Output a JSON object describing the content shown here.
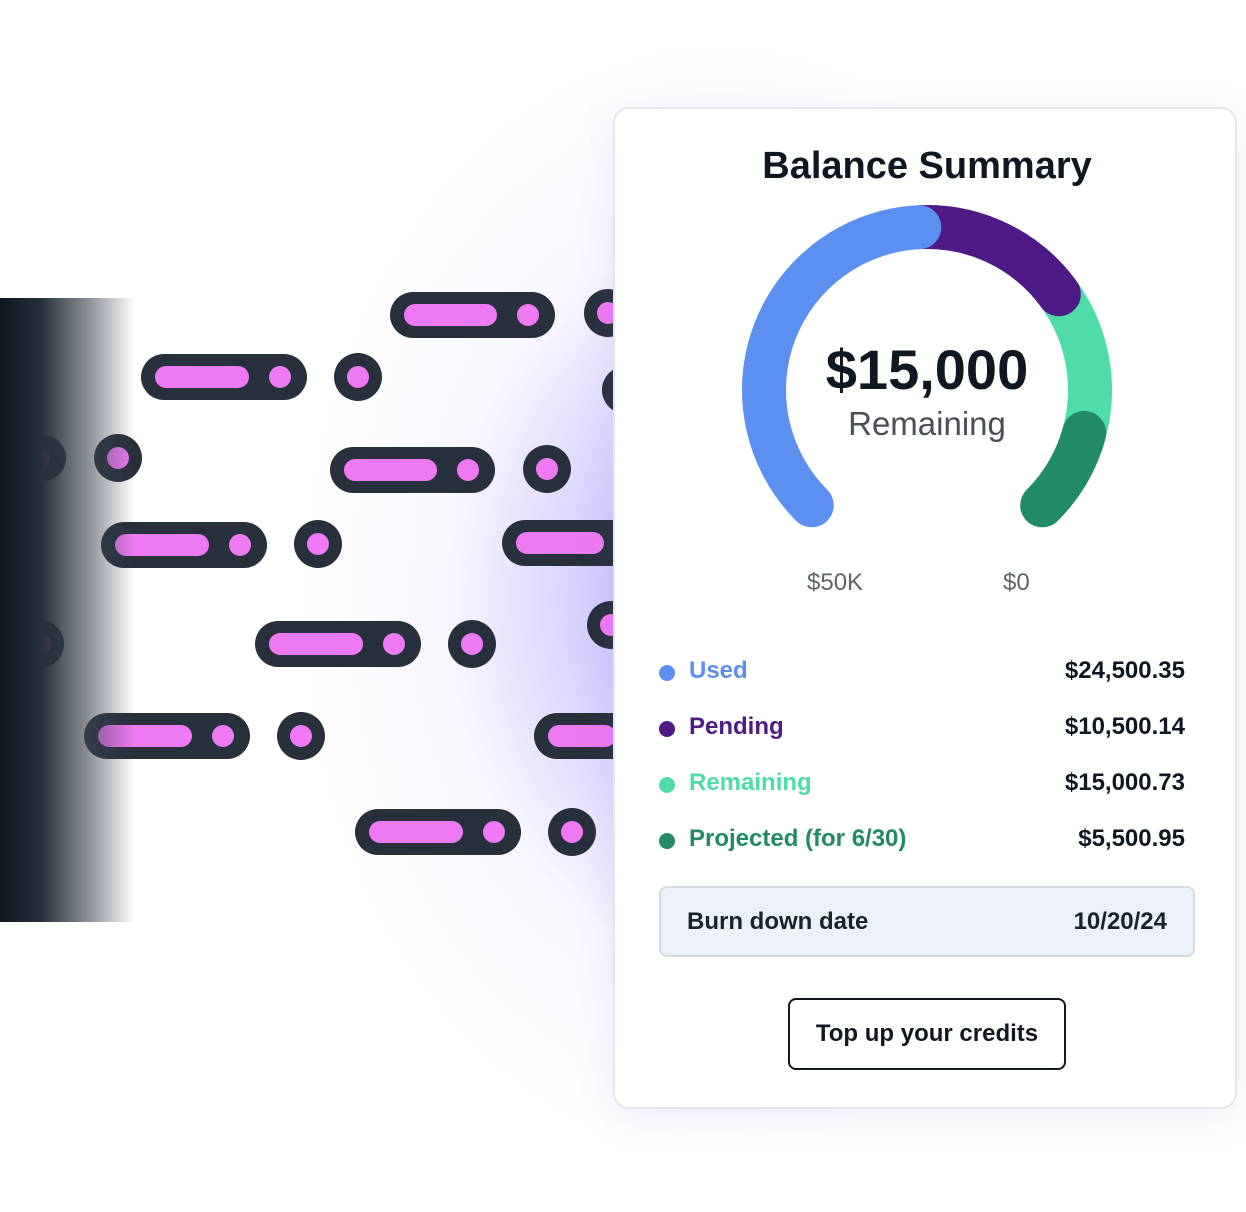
{
  "card": {
    "title": "Balance Summary",
    "gauge": {
      "value": "$15,000",
      "caption": "Remaining",
      "min_label": "$50K",
      "max_label": "$0",
      "segments": [
        {
          "name": "Used",
          "amount": 24500.35,
          "color": "#5b8ff0"
        },
        {
          "name": "Pending",
          "amount": 10500.14,
          "color": "#4e1a86"
        },
        {
          "name": "Remaining",
          "amount": 15000.73,
          "color": "#4fdca9"
        },
        {
          "name": "Projected (for 6/30)",
          "amount": 5500.95,
          "color": "#228a65"
        }
      ]
    },
    "legend": [
      {
        "label": "Used",
        "value": "$24,500.35",
        "color": "#5b8ff0"
      },
      {
        "label": "Pending",
        "value": "$10,500.14",
        "color": "#4e1a86"
      },
      {
        "label": "Remaining",
        "value": "$15,000.73",
        "color": "#4fdca9"
      },
      {
        "label": "Projected (for 6/30)",
        "value": "$5,500.95",
        "color": "#228a65"
      }
    ],
    "burn_down": {
      "label": "Burn down date",
      "value": "10/20/24"
    },
    "topup_button": "Top up your credits"
  },
  "decor": {
    "packet_color": "#ee7af3",
    "packet_outline": "#28303b"
  }
}
